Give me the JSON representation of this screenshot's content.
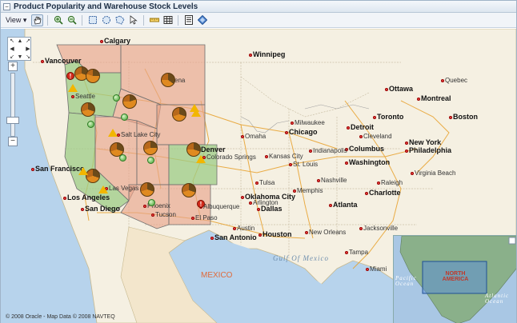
{
  "window": {
    "title": "Product Popularity and Warehouse Stock Levels"
  },
  "toolbar": {
    "view_label": "View"
  },
  "map": {
    "country_label": "MEXICO",
    "water_labels": [
      "Gulf Of Mexico"
    ],
    "cities": [
      {
        "name": "Calgary"
      },
      {
        "name": "Winnipeg"
      },
      {
        "name": "Vancouver"
      },
      {
        "name": "Seattle"
      },
      {
        "name": "Helena"
      },
      {
        "name": "Montreal"
      },
      {
        "name": "Ottawa"
      },
      {
        "name": "Quebec"
      },
      {
        "name": "Toronto"
      },
      {
        "name": "Boston"
      },
      {
        "name": "New York"
      },
      {
        "name": "Philadelphia"
      },
      {
        "name": "Washington"
      },
      {
        "name": "Chicago"
      },
      {
        "name": "Detroit"
      },
      {
        "name": "Milwaukee"
      },
      {
        "name": "Cleveland"
      },
      {
        "name": "Columbus"
      },
      {
        "name": "Indianapolis"
      },
      {
        "name": "Kansas City"
      },
      {
        "name": "St. Louis"
      },
      {
        "name": "Omaha"
      },
      {
        "name": "Denver"
      },
      {
        "name": "Colorado Springs"
      },
      {
        "name": "Salt Lake City"
      },
      {
        "name": "San Francisco"
      },
      {
        "name": "Los Angeles"
      },
      {
        "name": "San Diego"
      },
      {
        "name": "Las Vegas"
      },
      {
        "name": "Phoenix"
      },
      {
        "name": "Tucson"
      },
      {
        "name": "Albuquerque"
      },
      {
        "name": "El Paso"
      },
      {
        "name": "Dallas"
      },
      {
        "name": "Oklahoma City"
      },
      {
        "name": "Tulsa"
      },
      {
        "name": "Memphis"
      },
      {
        "name": "Nashville"
      },
      {
        "name": "Atlanta"
      },
      {
        "name": "Charlotte"
      },
      {
        "name": "Houston"
      },
      {
        "name": "San Antonio"
      },
      {
        "name": "New Orleans"
      },
      {
        "name": "Jacksonville"
      },
      {
        "name": "Tampa"
      },
      {
        "name": "Miami"
      },
      {
        "name": "Virginia Beach"
      },
      {
        "name": "Arlington"
      },
      {
        "name": "Austin"
      },
      {
        "name": "Raleigh"
      }
    ]
  },
  "overview": {
    "continent": "NORTH AMERICA",
    "ocean_left": "Pacific Ocean",
    "ocean_right": "Atlantic Ocean"
  },
  "footer": {
    "copyright": "© 2008 Oracle - Map Data © 2008 NAVTEQ"
  },
  "colors": {
    "region_red": "#e8a48c",
    "region_green": "#9ccc86",
    "border": "#6e6e6e"
  }
}
